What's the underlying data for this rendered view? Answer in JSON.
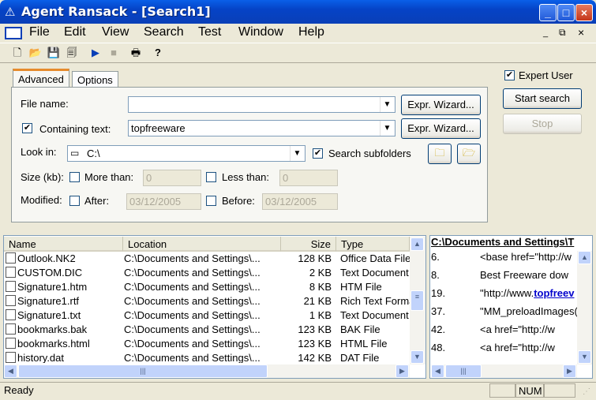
{
  "window": {
    "title": "Agent Ransack - [Search1]"
  },
  "menu": [
    "File",
    "Edit",
    "View",
    "Search",
    "Test",
    "Window",
    "Help"
  ],
  "tabs": {
    "advanced": "Advanced",
    "options": "Options"
  },
  "form": {
    "file_name_label": "File name:",
    "file_name_value": "",
    "containing_label": "Containing text:",
    "containing_value": "topfreeware",
    "containing_checked": true,
    "look_in_label": "Look in:",
    "look_in_value": "C:\\",
    "search_sub_label": "Search subfolders",
    "search_sub_checked": true,
    "size_label": "Size (kb):",
    "more_than_label": "More than:",
    "more_than_value": "0",
    "less_than_label": "Less than:",
    "less_than_value": "0",
    "modified_label": "Modified:",
    "after_label": "After:",
    "after_value": "03/12/2005",
    "before_label": "Before:",
    "before_value": "03/12/2005",
    "expr_wizard": "Expr. Wizard..."
  },
  "side": {
    "expert_label": "Expert User",
    "expert_checked": true,
    "start_label": "Start search",
    "stop_label": "Stop"
  },
  "results": {
    "columns": [
      "Name",
      "Location",
      "Size",
      "Type"
    ],
    "rows": [
      {
        "name": "Outlook.NK2",
        "location": "C:\\Documents and Settings\\...",
        "size": "128 KB",
        "type": "Office Data File"
      },
      {
        "name": "CUSTOM.DIC",
        "location": "C:\\Documents and Settings\\...",
        "size": "2 KB",
        "type": "Text Document"
      },
      {
        "name": "Signature1.htm",
        "location": "C:\\Documents and Settings\\...",
        "size": "8 KB",
        "type": "HTM File"
      },
      {
        "name": "Signature1.rtf",
        "location": "C:\\Documents and Settings\\...",
        "size": "21 KB",
        "type": "Rich Text Format"
      },
      {
        "name": "Signature1.txt",
        "location": "C:\\Documents and Settings\\...",
        "size": "1 KB",
        "type": "Text Document"
      },
      {
        "name": "bookmarks.bak",
        "location": "C:\\Documents and Settings\\...",
        "size": "123 KB",
        "type": "BAK File"
      },
      {
        "name": "bookmarks.html",
        "location": "C:\\Documents and Settings\\...",
        "size": "123 KB",
        "type": "HTML File"
      },
      {
        "name": "history.dat",
        "location": "C:\\Documents and Settings\\...",
        "size": "142 KB",
        "type": "DAT File"
      }
    ]
  },
  "preview": {
    "header": "C:\\Documents and Settings\\T",
    "lines": [
      {
        "num": "6.",
        "pre": "<base href=\"http://w",
        "hit": ""
      },
      {
        "num": "8.",
        "pre": "Best Freeware dow",
        "hit": ""
      },
      {
        "num": "19.",
        "pre": "\"http://www.",
        "hit": "topfreev"
      },
      {
        "num": "37.",
        "pre": "\"MM_preloadImages('i",
        "hit": ""
      },
      {
        "num": "42.",
        "pre": "<a href=\"http://w",
        "hit": ""
      },
      {
        "num": "48.",
        "pre": "<a href=\"http://w",
        "hit": ""
      },
      {
        "num": "",
        "pre": "",
        "hit": ""
      }
    ]
  },
  "status": {
    "text": "Ready",
    "num": "NUM"
  }
}
